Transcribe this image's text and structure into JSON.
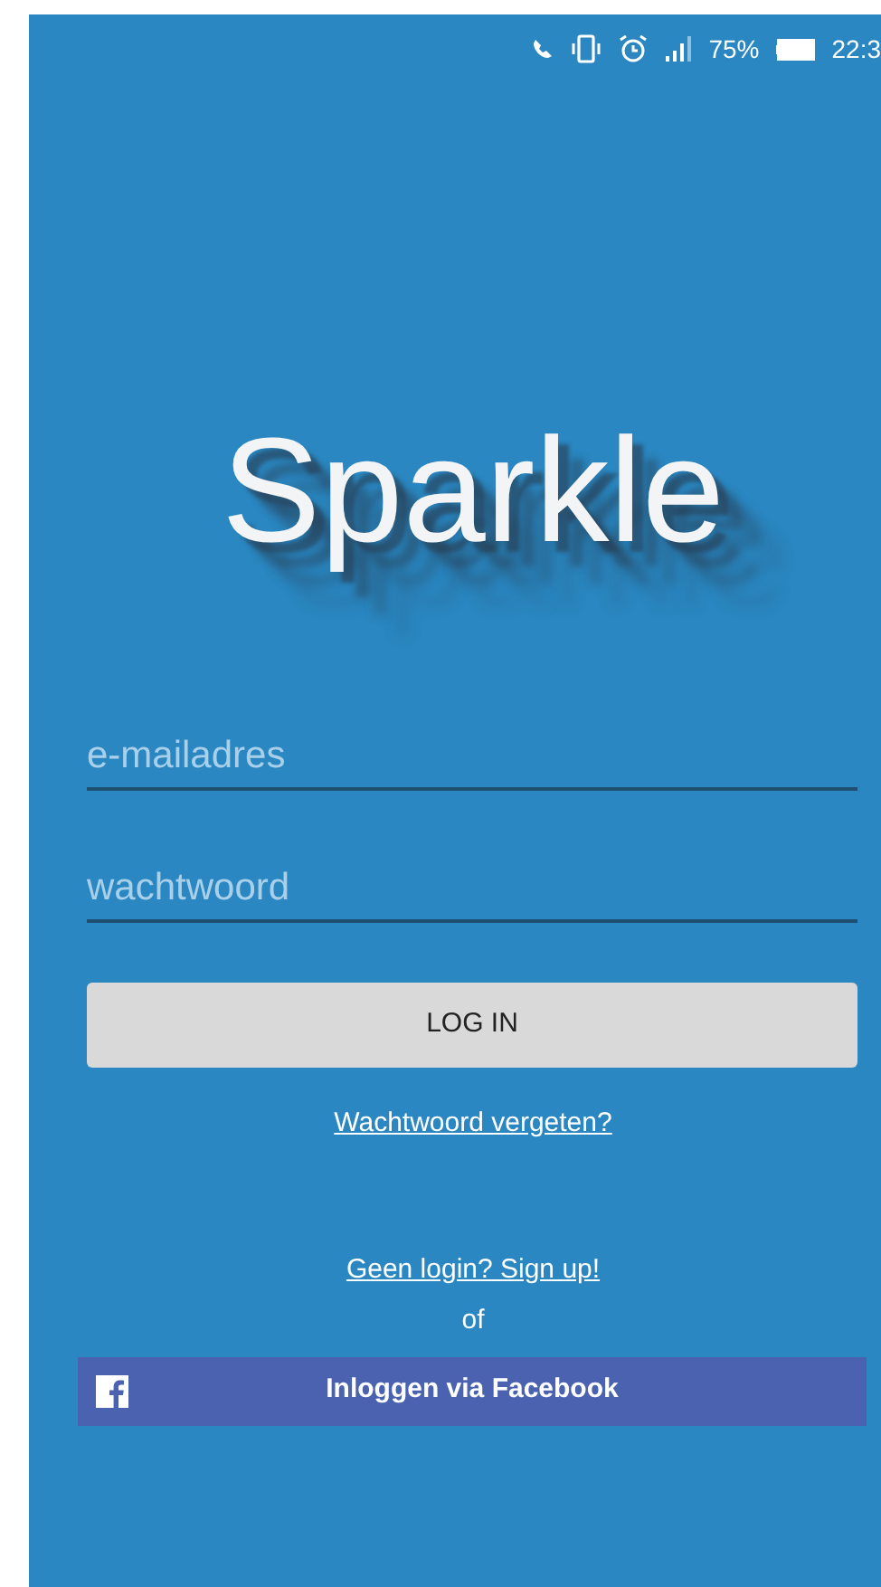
{
  "status_bar": {
    "battery": "75%",
    "time": "22:3"
  },
  "logo": "Sparkle",
  "fields": [
    {
      "placeholder": "e-mailadres"
    },
    {
      "placeholder": "wachtwoord"
    }
  ],
  "login_button": "LOG IN",
  "forgot_link": "Wachtwoord vergeten?",
  "signup_link": "Geen login? Sign up!",
  "separator": "of",
  "facebook_button": "Inloggen via Facebook"
}
